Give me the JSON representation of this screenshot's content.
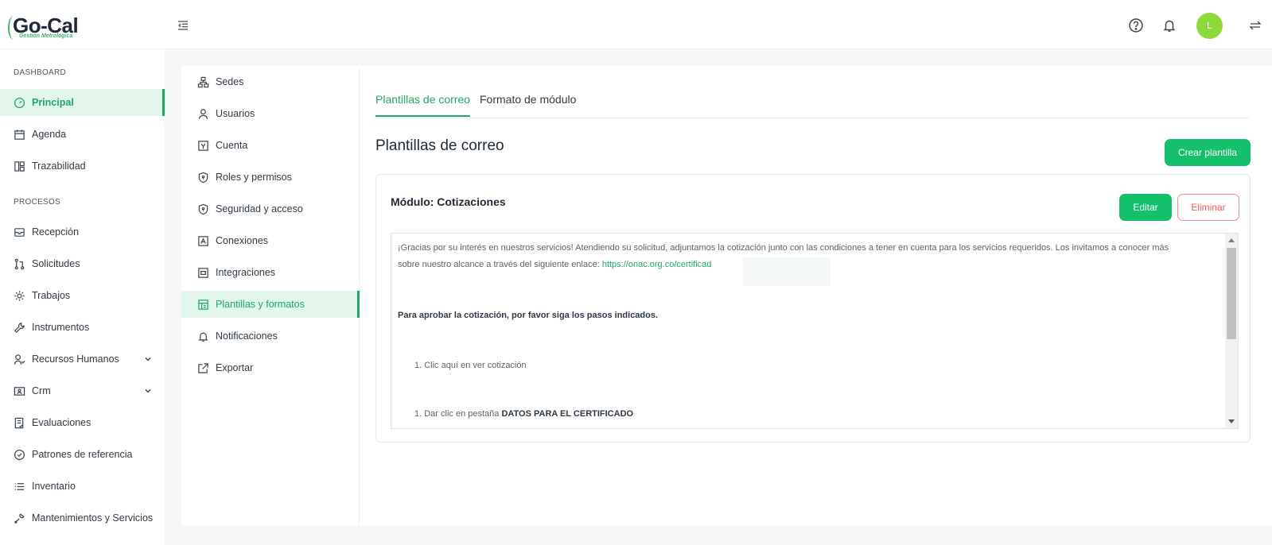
{
  "app": {
    "logo_text": "Go-Cal",
    "logo_subtitle": "Gestión Metrológica",
    "avatar_initial": "L"
  },
  "sidebar": {
    "sections": [
      {
        "label": "DASHBOARD"
      },
      {
        "label": "PROCESOS"
      }
    ],
    "items": [
      {
        "label": "Principal",
        "icon": "gauge-icon",
        "active": true
      },
      {
        "label": "Agenda",
        "icon": "calendar-icon"
      },
      {
        "label": "Trazabilidad",
        "icon": "flow-icon"
      },
      {
        "label": "Recepción",
        "icon": "inbox-icon"
      },
      {
        "label": "Solicitudes",
        "icon": "pull-request-icon"
      },
      {
        "label": "Trabajos",
        "icon": "gear-icon"
      },
      {
        "label": "Instrumentos",
        "icon": "wrench-icon"
      },
      {
        "label": "Recursos Humanos",
        "icon": "users-icon",
        "expandable": true
      },
      {
        "label": "Crm",
        "icon": "contact-card-icon",
        "expandable": true
      },
      {
        "label": "Evaluaciones",
        "icon": "document-check-icon"
      },
      {
        "label": "Patrones de referencia",
        "icon": "shield-check-icon"
      },
      {
        "label": "Inventario",
        "icon": "list-icon"
      },
      {
        "label": "Mantenimientos y Servicios",
        "icon": "tools-icon"
      }
    ]
  },
  "settings_menu": {
    "items": [
      {
        "label": "Sedes",
        "icon": "sitemap-icon"
      },
      {
        "label": "Usuarios",
        "icon": "user-icon"
      },
      {
        "label": "Cuenta",
        "icon": "account-icon"
      },
      {
        "label": "Roles y permisos",
        "icon": "shield-icon"
      },
      {
        "label": "Seguridad y acceso",
        "icon": "shield-icon"
      },
      {
        "label": "Conexiones",
        "icon": "connections-icon"
      },
      {
        "label": "Integraciones",
        "icon": "integration-icon"
      },
      {
        "label": "Plantillas y formatos",
        "icon": "template-icon",
        "active": true
      },
      {
        "label": "Notificaciones",
        "icon": "bell-icon"
      },
      {
        "label": "Exportar",
        "icon": "export-icon"
      }
    ]
  },
  "main": {
    "tabs": [
      {
        "label": "Plantillas de correo",
        "active": true
      },
      {
        "label": "Formato de módulo",
        "active": false
      }
    ],
    "title": "Plantillas de correo",
    "create_button": "Crear plantilla",
    "card": {
      "title": "Módulo: Cotizaciones",
      "edit_button": "Editar",
      "delete_button": "Eliminar",
      "body": {
        "intro_line1": "¡Gracias por su interés en nuestros servicios! Atendiendo su solicitud, adjuntamos la cotización junto con las condiciones a tener en cuenta para los servicios requeridos. Los invitamos a conocer más",
        "intro_line2_prefix": "sobre nuestro alcance a través del siguiente enlace: ",
        "link": "https://onac.org.co/certificad",
        "approve_text": "Para aprobar la cotización, por favor siga los pasos indicados.",
        "step1": "1. Clic aquí en ver cotización",
        "step2_prefix": "1. Dar clic en pestaña ",
        "step2_bold": "DATOS PARA EL CERTIFICADO"
      }
    }
  },
  "colors": {
    "accent": "#14c06a",
    "accent_text": "#1fa866",
    "active_bg": "#e3f6ec",
    "danger": "#ef5a5a",
    "avatar": "#8cd93a"
  }
}
